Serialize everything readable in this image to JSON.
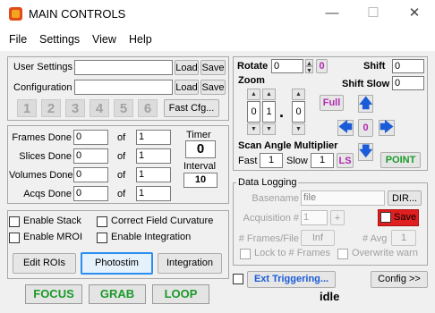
{
  "window": {
    "title": "MAIN CONTROLS",
    "minimize": "—",
    "maximize": "☐",
    "close": "✕"
  },
  "menu": [
    "File",
    "Settings",
    "View",
    "Help"
  ],
  "settings": {
    "user_settings_label": "User Settings",
    "configuration_label": "Configuration",
    "load": "Load",
    "save": "Save",
    "slots": [
      "1",
      "2",
      "3",
      "4",
      "5",
      "6"
    ],
    "fast_cfg": "Fast Cfg..."
  },
  "counters": {
    "frames_label": "Frames Done",
    "frames_done": "0",
    "frames_total": "1",
    "slices_label": "Slices Done",
    "slices_done": "0",
    "slices_total": "1",
    "volumes_label": "Volumes Done",
    "volumes_done": "0",
    "volumes_total": "1",
    "acqs_label": "Acqs Done",
    "acqs_done": "0",
    "acqs_total": "1",
    "of": "of",
    "timer_label": "Timer",
    "timer_value": "0",
    "interval_label": "Interval",
    "interval_value": "10"
  },
  "options": {
    "enable_stack": "Enable Stack",
    "correct_field_curvature": "Correct Field Curvature",
    "enable_mroi": "Enable MROI",
    "enable_integration": "Enable Integration",
    "edit_rois": "Edit ROIs",
    "photostim": "Photostim",
    "integration": "Integration"
  },
  "actions": {
    "focus": "FOCUS",
    "grab": "GRAB",
    "loop": "LOOP"
  },
  "scan": {
    "rotate_label": "Rotate",
    "rotate_value": "0",
    "rotate_reset": "0",
    "zoom_label": "Zoom",
    "zoom_digits": [
      "0",
      "1",
      "0"
    ],
    "zoom_dot": ".",
    "shift_label": "Shift",
    "shift_value": "0",
    "shift_slow_label": "Shift Slow",
    "shift_slow_value": "0",
    "full": "Full",
    "center": "0",
    "up_arrow": "🡅",
    "down_arrow": "🡇",
    "left_arrow": "🡄",
    "right_arrow": "🡆",
    "multiplier_label": "Scan Angle Multiplier",
    "fast_label": "Fast",
    "fast_value": "1",
    "slow_label": "Slow",
    "slow_value": "1",
    "ls": "LS",
    "point": "POINT"
  },
  "logging": {
    "title": "Data Logging",
    "basename_label": "Basename",
    "basename_value": "file",
    "dir": "DIR...",
    "acq_label": "Acquisition #",
    "acq_value": "1",
    "acq_plus": "+",
    "save": "Save",
    "frames_file_label": "# Frames/File",
    "frames_file_value": "Inf",
    "avg_label": "# Avg",
    "avg_value": "1",
    "lock_label": "Lock to # Frames",
    "overwrite_label": "Overwrite warn"
  },
  "footer": {
    "ext_triggering": "Ext Triggering...",
    "status": "idle",
    "config": "Config >>"
  },
  "colors": {
    "green": "#1a9a2a",
    "blue": "#1a5bd8",
    "magenta": "#b12ab1",
    "save_red": "#e02020",
    "photostim_focus": "#2a8ef0"
  }
}
